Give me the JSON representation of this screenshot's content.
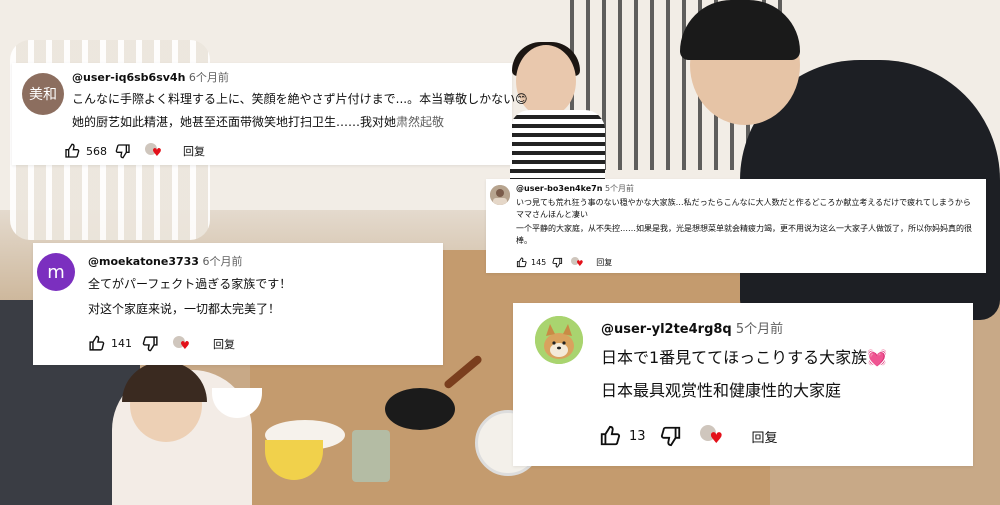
{
  "comments": [
    {
      "avatar_text": "美和",
      "avatar_color": "#8c6e5f",
      "handle": "@user-iq6sb6sv4h",
      "time": "6个月前",
      "line1": "こんなに手際よく料理する上に、笑顔を絶やさず片付けまで...。本当尊敬しかない😊",
      "line2": "她的厨艺如此精湛，她甚至还面带微笑地打扫卫生……我对她",
      "line2_gray": "肃然起敬",
      "likes": "568",
      "reply": "回复"
    },
    {
      "avatar_color": "#b7a48f",
      "handle": "@user-bo3en4ke7n",
      "time": "5个月前",
      "line1": "いつ見ても荒れ狂う事のない穏やかな大家族…私だったらこんなに大人数だと作るどころか献立考えるだけで疲れてしまうからママさんほんと凄い",
      "line2": "一个平静的大家庭，从不失控……如果是我，光是想想菜单就会精疲力竭，更不用说为这么一大家子人做饭了，所以你妈妈真的很棒。",
      "likes": "145",
      "reply": "回复"
    },
    {
      "avatar_text": "m",
      "avatar_color": "#7b2fbf",
      "handle": "@moekatone3733",
      "time": "6个月前",
      "line1": "全てがパーフェクト過ぎる家族です！",
      "line2": "对这个家庭来说，一切都太完美了！",
      "likes": "141",
      "reply": "回复"
    },
    {
      "avatar_color": "#d9a25e",
      "handle": "@user-yl2te4rg8q",
      "time": "5个月前",
      "line1": "日本で1番見ててほっこりする大家族💓",
      "line2": "日本最具观赏性和健康性的大家庭",
      "likes": "13",
      "reply": "回复"
    }
  ]
}
